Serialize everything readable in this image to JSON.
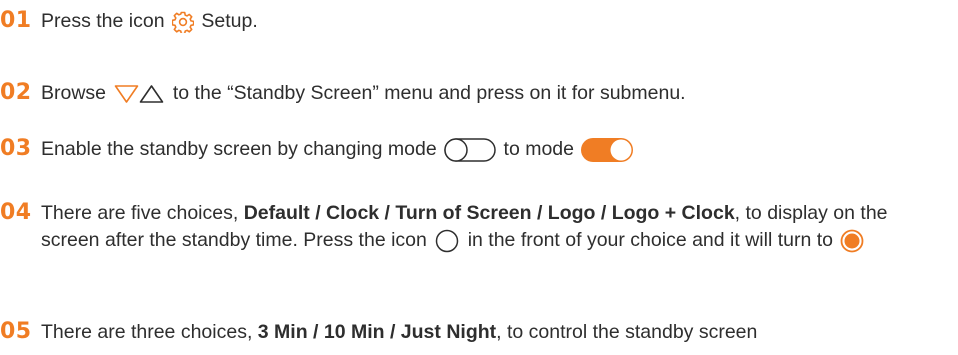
{
  "colors": {
    "accent": "#f07d24",
    "text": "#2e2e2e"
  },
  "steps": [
    {
      "number": "01",
      "text_a": "Press the icon",
      "icon": "gear-icon",
      "text_b": "Setup."
    },
    {
      "number": "02",
      "text_a": "Browse",
      "icons": [
        "triangle-down-icon",
        "triangle-up-icon"
      ],
      "text_b": "to the “Standby Screen” menu and press on it for submenu."
    },
    {
      "number": "03",
      "text_a": "Enable the standby screen by changing mode",
      "icon_off": "toggle-off-icon",
      "text_b": "to mode",
      "icon_on": "toggle-on-icon"
    },
    {
      "number": "04",
      "text_a": "There are five choices,",
      "choices": "Default / Clock / Turn of Screen / Logo / Logo + Clock",
      "text_b": ", to display on the screen after the standby time. Press the icon",
      "icon_off": "radio-unselected-icon",
      "text_c": "in the front of your choice and it will turn to",
      "icon_on": "radio-selected-icon"
    },
    {
      "number": "05",
      "text_a": "There are three choices,",
      "choices": "3 Min / 10 Min / Just Night",
      "text_b": ", to control the standby screen"
    }
  ]
}
